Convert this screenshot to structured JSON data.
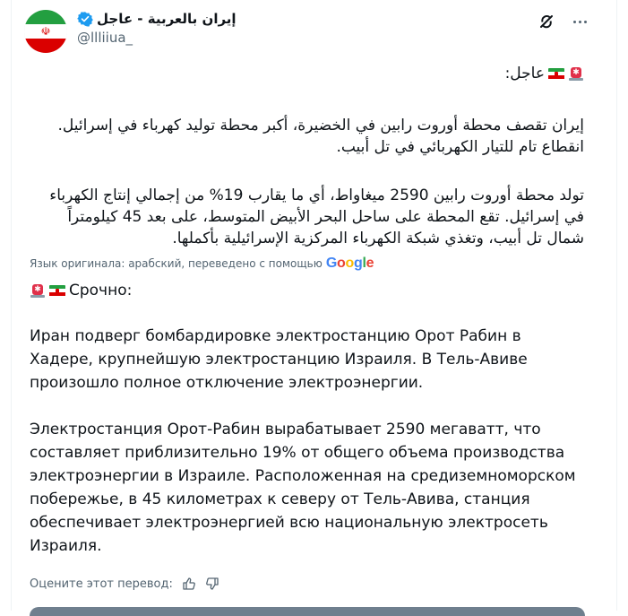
{
  "author": {
    "display_name": "إيران بالعربية - عاجل",
    "handle": "@llliiua_",
    "avatar_icon": "iran-flag-avatar",
    "verified_color": "#1d9bf0"
  },
  "actions": {
    "grok_icon": "grok-icon",
    "more_icon": "more-dots-icon"
  },
  "post": {
    "original": {
      "urgent_label": "عاجل:",
      "paragraph_1_line_1": "إيران تقصف محطة أوروت رابين في الخضيرة، أكبر محطة توليد كهرباء في إسرائيل.",
      "paragraph_1_line_2": "انقطاع تام للتيار الكهربائي في تل أبيب.",
      "paragraph_2_line_1": "تولد محطة أوروت رابين 2590 ميغاواط، أي ما يقارب 19% من إجمالي إنتاج الكهرباء",
      "paragraph_2_line_2": "في إسرائيل. تقع المحطة على ساحل البحر الأبيض المتوسط، على بعد 45 كيلومتراً",
      "paragraph_2_line_3": "شمال تل أبيب، وتغذي شبكة الكهرباء المركزية الإسرائيلية بأكملها."
    },
    "translation_note": "Язык оригинала: арабский, переведено с помощью",
    "translation_provider": "Google",
    "translated": {
      "urgent_label": "Срочно:",
      "paragraph_1": "Иран подверг бомбардировке электростанцию Орот Рабин в Хадере, крупнейшую электростанцию Израиля. В Тель-Авиве произошло полное отключение электроэнергии.",
      "paragraph_2": "Электростанция Орот-Рабин вырабатывает 2590 мегаватт, что составляет приблизительно 19% от общего объема производства электроэнергии в Израиле. Расположенная на средиземноморском побережье, в 45 километрах к северу от Тель-Авива, станция обеспечивает электроэнергией всю национальную электросеть Израиля."
    },
    "emoji_icons": [
      "siren-emoji",
      "iran-flag-emoji"
    ]
  },
  "rating": {
    "label": "Оцените этот перевод:",
    "thumbs_up_icon": "thumbs-up-icon",
    "thumbs_down_icon": "thumbs-down-icon"
  }
}
